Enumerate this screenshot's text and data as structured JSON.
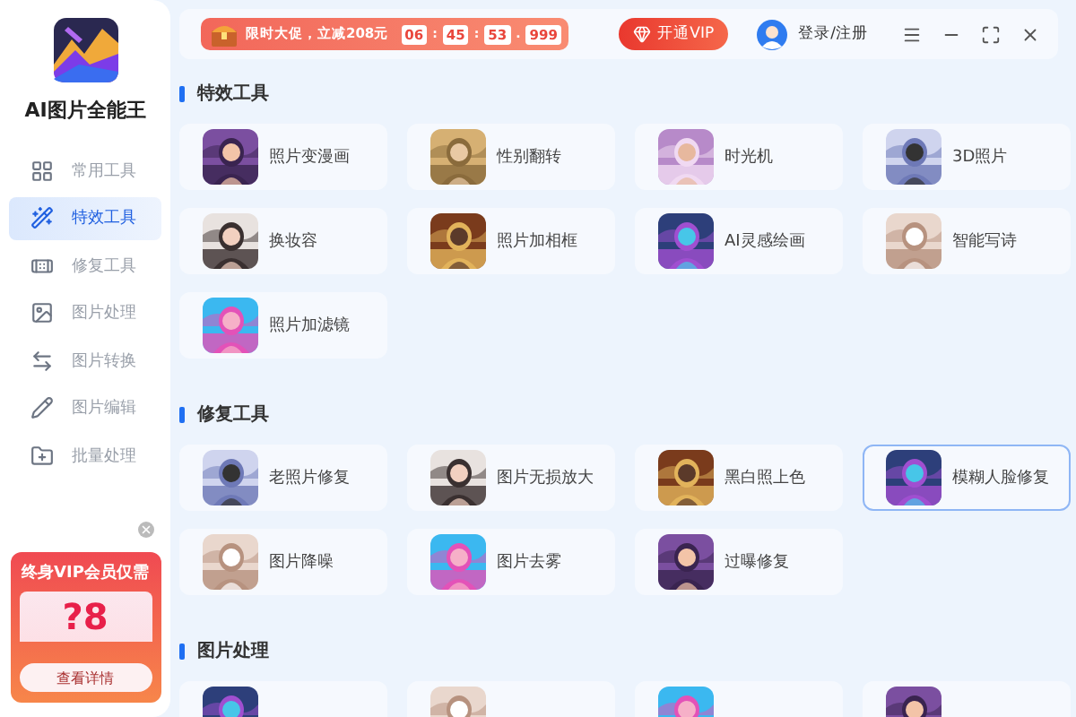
{
  "app": {
    "name": "AI图片全能王"
  },
  "sidebar": {
    "items": [
      {
        "label": "常用工具",
        "selected": false
      },
      {
        "label": "特效工具",
        "selected": true
      },
      {
        "label": "修复工具",
        "selected": false
      },
      {
        "label": "图片处理",
        "selected": false
      },
      {
        "label": "图片转换",
        "selected": false
      },
      {
        "label": "图片编辑",
        "selected": false
      },
      {
        "label": "批量处理",
        "selected": false
      }
    ]
  },
  "promo_card": {
    "title": "终身VIP会员仅需",
    "price": "?8",
    "button": "查看详情"
  },
  "top_bar": {
    "promo_text": "限时大促，立减208元",
    "timer": [
      "06",
      ":",
      "45",
      ":",
      "53",
      ".",
      "999"
    ],
    "vip_button": "开通VIP",
    "login": "登录/注册"
  },
  "sections": [
    {
      "title": "特效工具",
      "cards": [
        {
          "label": "照片变漫画",
          "selected": false
        },
        {
          "label": "性别翻转",
          "selected": false
        },
        {
          "label": "时光机",
          "selected": false
        },
        {
          "label": "3D照片",
          "selected": false
        },
        {
          "label": "换妆容",
          "selected": false
        },
        {
          "label": "照片加相框",
          "selected": false
        },
        {
          "label": "AI灵感绘画",
          "selected": false
        },
        {
          "label": "智能写诗",
          "selected": false
        },
        {
          "label": "照片加滤镜",
          "selected": false
        }
      ]
    },
    {
      "title": "修复工具",
      "cards": [
        {
          "label": "老照片修复",
          "selected": false
        },
        {
          "label": "图片无损放大",
          "selected": false
        },
        {
          "label": "黑白照上色",
          "selected": false
        },
        {
          "label": "模糊人脸修复",
          "selected": true
        },
        {
          "label": "图片降噪",
          "selected": false
        },
        {
          "label": "图片去雾",
          "selected": false
        },
        {
          "label": "过曝修复",
          "selected": false
        }
      ]
    },
    {
      "title": "图片处理",
      "cards": [
        {
          "selected": false
        },
        {
          "selected": false
        },
        {
          "selected": false
        },
        {
          "selected": false
        }
      ]
    }
  ]
}
